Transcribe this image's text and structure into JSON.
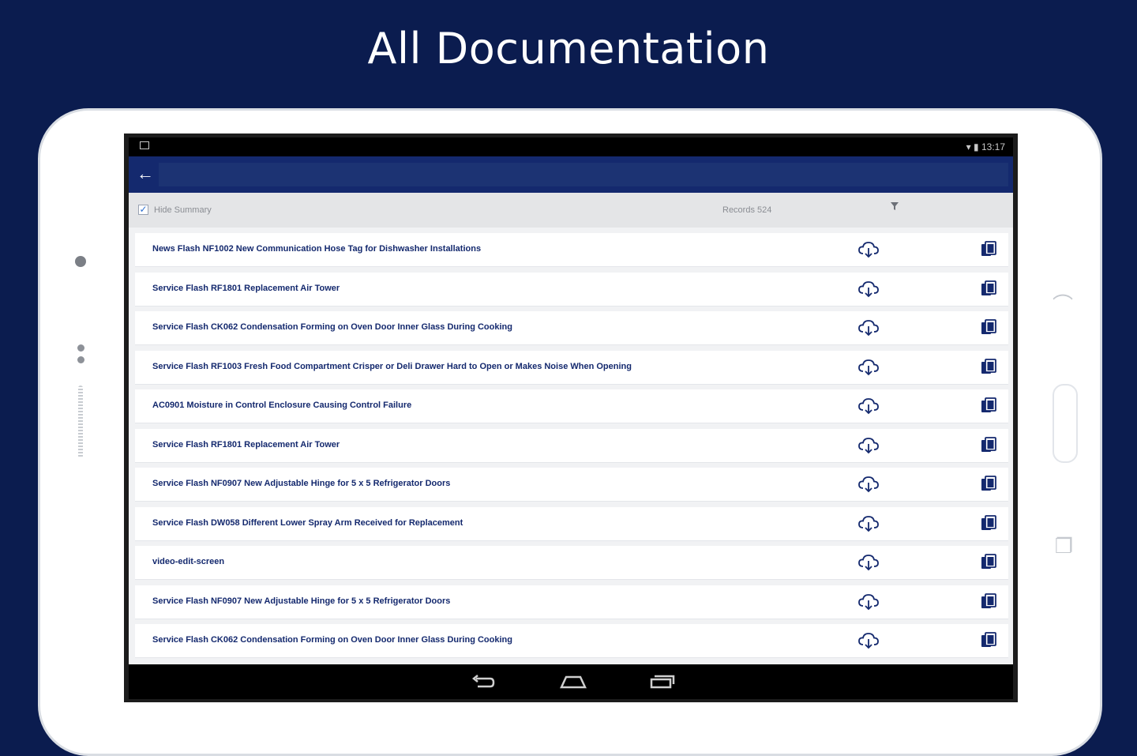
{
  "headline": "All Documentation",
  "status_bar": {
    "time": "13:17"
  },
  "toolbar": {
    "hide_summary_label": "Hide Summary",
    "hide_summary_checked": true,
    "records_label": "Records 524"
  },
  "documents": [
    {
      "title": "News Flash NF1002 New Communication Hose Tag for Dishwasher Installations"
    },
    {
      "title": "Service Flash RF1801 Replacement Air Tower"
    },
    {
      "title": "Service Flash CK062 Condensation Forming on Oven Door Inner Glass During Cooking"
    },
    {
      "title": "Service Flash RF1003 Fresh Food Compartment Crisper or Deli Drawer Hard to Open or Makes Noise When Opening"
    },
    {
      "title": "AC0901 Moisture in Control Enclosure Causing Control Failure"
    },
    {
      "title": "Service Flash RF1801 Replacement Air Tower"
    },
    {
      "title": "Service Flash NF0907 New Adjustable Hinge for 5 x 5 Refrigerator Doors"
    },
    {
      "title": "Service Flash DW058 Different Lower Spray Arm Received for Replacement"
    },
    {
      "title": "video-edit-screen"
    },
    {
      "title": "Service Flash NF0907 New Adjustable Hinge for 5 x 5 Refrigerator Doors"
    },
    {
      "title": "Service Flash CK062 Condensation Forming on Oven Door Inner Glass During Cooking"
    }
  ],
  "colors": {
    "background": "#0b1c4f",
    "app_bar": "#14296e",
    "title_text": "#14296e",
    "icon": "#14296e"
  },
  "icons": {
    "download": "cloud-download-icon",
    "copy": "copy-icon",
    "filter": "filter-icon",
    "back": "back-arrow-icon"
  }
}
